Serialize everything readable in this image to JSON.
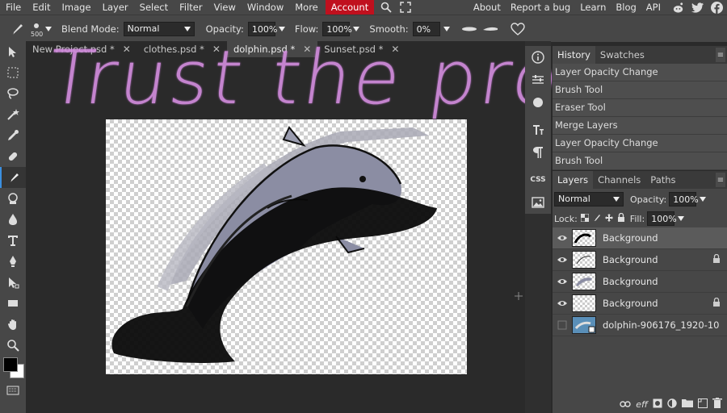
{
  "menubar": {
    "items": [
      "File",
      "Edit",
      "Image",
      "Layer",
      "Select",
      "Filter",
      "View",
      "Window",
      "More"
    ],
    "account": "Account",
    "right_links": [
      "About",
      "Report a bug",
      "Learn",
      "Blog",
      "API"
    ]
  },
  "options": {
    "brush_size": "500",
    "blend_mode_label": "Blend Mode:",
    "blend_mode_value": "Normal",
    "opacity_label": "Opacity:",
    "opacity_value": "100%",
    "flow_label": "Flow:",
    "flow_value": "100%",
    "smooth_label": "Smooth:",
    "smooth_value": "0%"
  },
  "tabs": [
    {
      "label": "New Project.psd *"
    },
    {
      "label": "clothes.psd *"
    },
    {
      "label": "dolphin.psd *",
      "active": true
    },
    {
      "label": "Sunset.psd *"
    }
  ],
  "canvas": {
    "overlay_text": "Trust the process..."
  },
  "midcol": {
    "css_label": "CSS"
  },
  "history": {
    "tabs": [
      "History",
      "Swatches"
    ],
    "items": [
      "Layer Opacity Change",
      "Brush Tool",
      "Eraser Tool",
      "Merge Layers",
      "Layer Opacity Change",
      "Brush Tool"
    ]
  },
  "layers": {
    "tabs": [
      "Layers",
      "Channels",
      "Paths"
    ],
    "blend": "Normal",
    "opacity_label": "Opacity:",
    "opacity_value": "100%",
    "lock_label": "Lock:",
    "fill_label": "Fill:",
    "fill_value": "100%",
    "rows": [
      {
        "name": "Background",
        "selected": true,
        "visible": true,
        "locked": false
      },
      {
        "name": "Background",
        "selected": false,
        "visible": true,
        "locked": true
      },
      {
        "name": "Background",
        "selected": false,
        "visible": true,
        "locked": false
      },
      {
        "name": "Background",
        "selected": false,
        "visible": true,
        "locked": true
      },
      {
        "name": "dolphin-906176_1920-10",
        "selected": false,
        "visible": false,
        "locked": false
      }
    ],
    "eff_label": "eff"
  },
  "colors": {
    "accent": "#3b8fe0",
    "account_red": "#c0101e",
    "scribble": "#d58ee0"
  }
}
